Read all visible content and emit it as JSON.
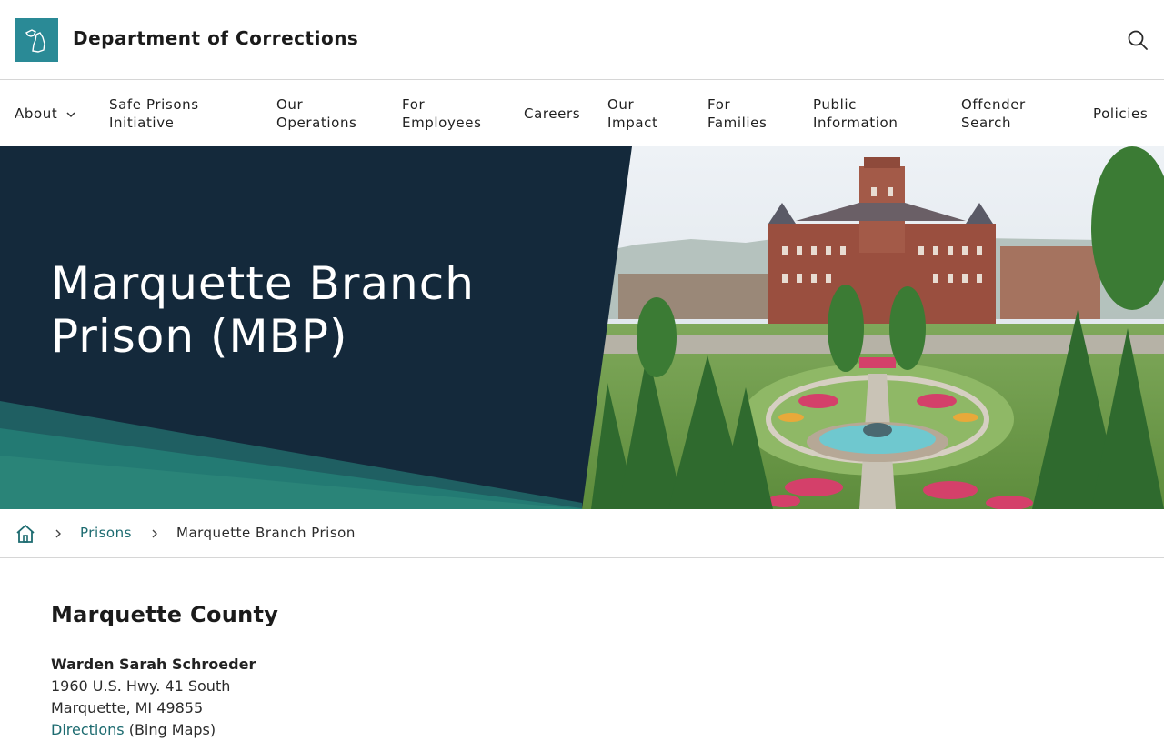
{
  "header": {
    "site_title": "Department of Corrections"
  },
  "nav": {
    "items": [
      {
        "label": "About",
        "has_dropdown": true
      },
      {
        "label": "Safe Prisons\nInitiative"
      },
      {
        "label": "Our\nOperations"
      },
      {
        "label": "For\nEmployees"
      },
      {
        "label": "Careers"
      },
      {
        "label": "Our\nImpact"
      },
      {
        "label": "For\nFamilies"
      },
      {
        "label": "Public\nInformation"
      },
      {
        "label": "Offender\nSearch"
      },
      {
        "label": "Policies"
      }
    ]
  },
  "hero": {
    "title": "Marquette Branch Prison (MBP)"
  },
  "breadcrumb": {
    "home_icon": "home-icon",
    "items": [
      "Prisons",
      "Marquette Branch Prison"
    ]
  },
  "content": {
    "county": "Marquette County",
    "warden": "Warden Sarah Schroeder",
    "address_line1": "1960 U.S. Hwy. 41 South",
    "address_line2": "Marquette, MI 49855",
    "directions_link": "Directions",
    "directions_note": " (Bing Maps)"
  },
  "colors": {
    "hero_dark": "#14293b",
    "hero_teal": "#237a73",
    "logo_bg": "#2a8a96",
    "link": "#1d6b70"
  }
}
